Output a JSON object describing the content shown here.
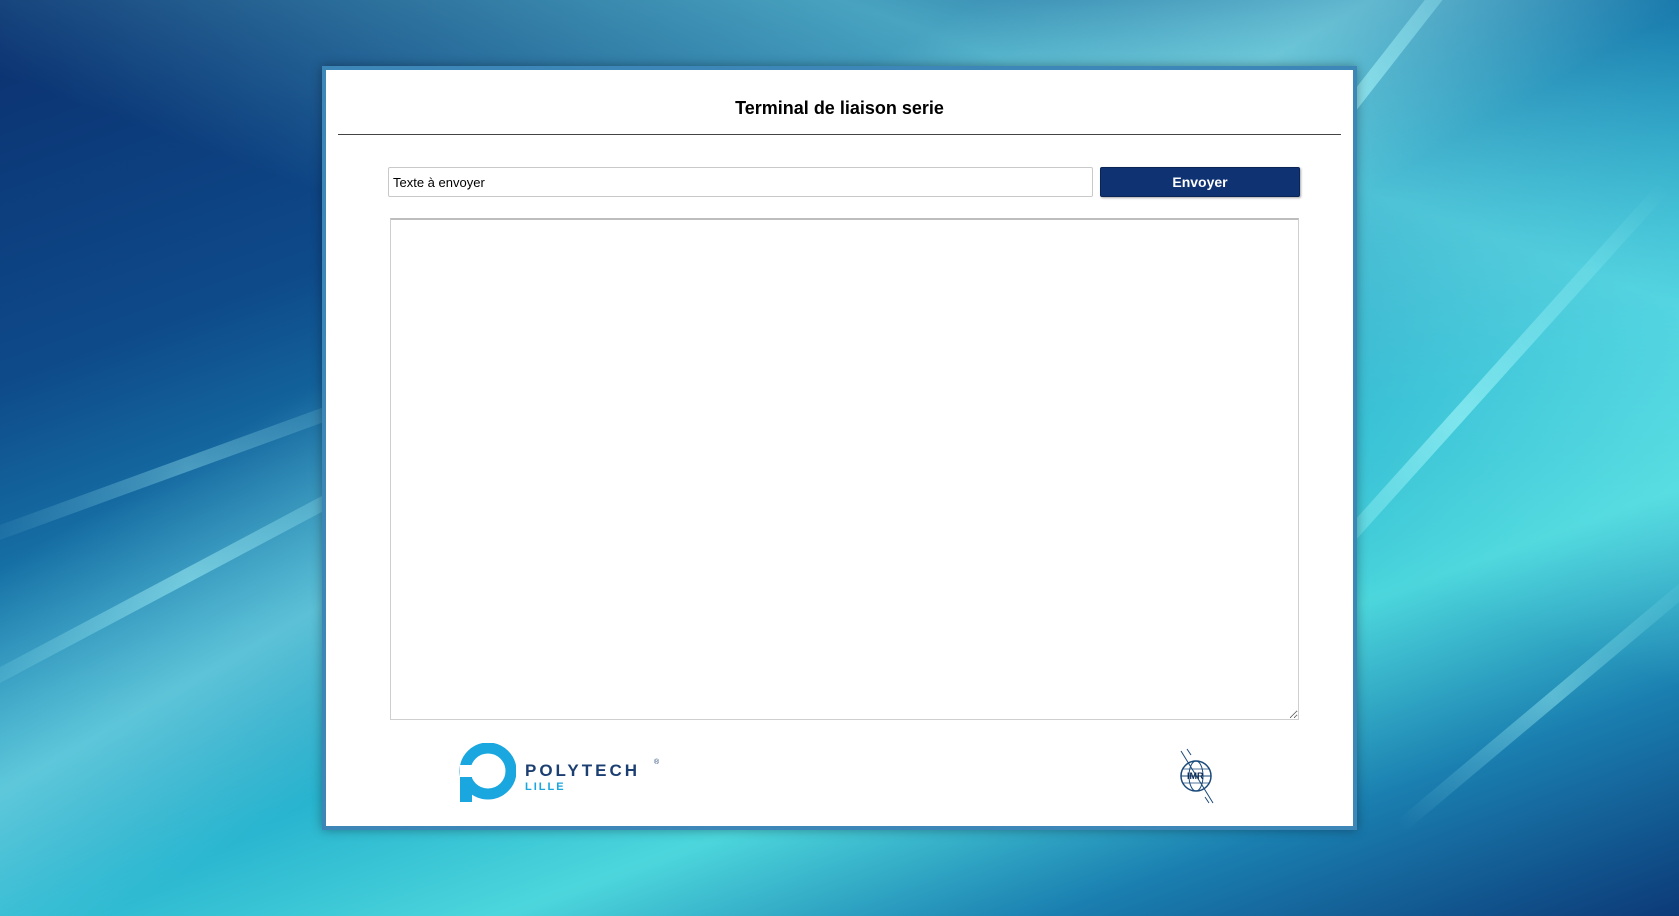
{
  "window": {
    "title": "Terminal de liaison serie"
  },
  "send_form": {
    "input_placeholder": "Texte à envoyer",
    "input_value": "",
    "send_button_label": "Envoyer"
  },
  "output": {
    "content": ""
  },
  "logos": {
    "left": {
      "name": "POLYTECH",
      "city": "LILLE",
      "registered": "®",
      "mark_icon": "polytech-p-icon",
      "color_dark": "#1c3f72",
      "color_accent": "#1aa6de"
    },
    "right": {
      "label": "IMR",
      "icon": "imr-globe-icon"
    }
  },
  "colors": {
    "window_border": "#3d87b8",
    "button_bg": "#0f3273",
    "button_text": "#ffffff"
  }
}
